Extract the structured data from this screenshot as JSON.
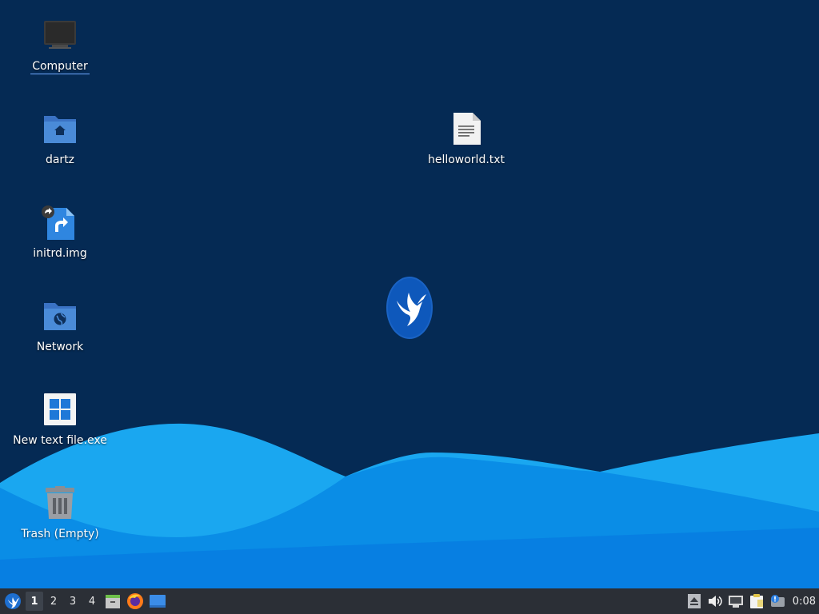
{
  "desktop": {
    "icons": [
      {
        "label": "Computer",
        "icon": "computer-icon",
        "selected": true
      },
      {
        "label": "dartz",
        "icon": "home-folder-icon"
      },
      {
        "label": "initrd.img",
        "icon": "symlink-file-icon"
      },
      {
        "label": "Network",
        "icon": "network-folder-icon"
      },
      {
        "label": "New text file.exe",
        "icon": "windows-logo-icon"
      },
      {
        "label": "Trash (Empty)",
        "icon": "trash-icon"
      },
      {
        "label": "helloworld.txt",
        "icon": "text-file-icon"
      }
    ]
  },
  "colors": {
    "background": "#052a54",
    "wave_light": "#1aa7f0",
    "wave_mid": "#0a8de6",
    "wave_dark": "#0577e0",
    "taskbar": "#2b2f36",
    "folder": "#4a8bd8"
  },
  "taskbar": {
    "menu_icon": "bird-logo-icon",
    "workspaces": [
      "1",
      "2",
      "3",
      "4"
    ],
    "active_workspace": "1",
    "launchers": [
      "file-manager-icon",
      "firefox-icon",
      "desktop-icon"
    ],
    "tray": [
      "eject-icon",
      "volume-icon",
      "network-icon",
      "clipboard-icon",
      "notification-icon"
    ],
    "clock": "0:08"
  }
}
